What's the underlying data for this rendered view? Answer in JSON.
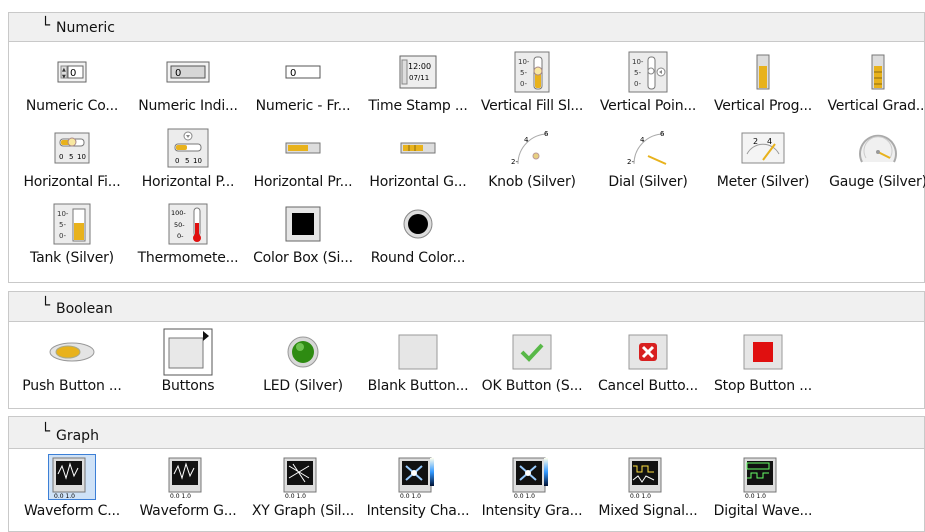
{
  "sections": [
    {
      "header": "Numeric",
      "header_mark": "└",
      "items": [
        {
          "label": "Numeric Co...",
          "icon": "numeric-control-icon"
        },
        {
          "label": "Numeric Indi...",
          "icon": "numeric-indicator-icon"
        },
        {
          "label": "Numeric - Fr...",
          "icon": "numeric-frameless-icon"
        },
        {
          "label": "Time Stamp ...",
          "icon": "timestamp-icon",
          "icon_text": [
            "12:00",
            "07/11"
          ]
        },
        {
          "label": "Vertical Fill Sl...",
          "icon": "vertical-fill-slide-icon",
          "icon_text": [
            "10-",
            "5-",
            "0-"
          ]
        },
        {
          "label": "Vertical Poin...",
          "icon": "vertical-pointer-slide-icon",
          "icon_text": [
            "10-",
            "5-",
            "0-"
          ]
        },
        {
          "label": "Vertical Prog...",
          "icon": "vertical-progress-bar-icon"
        },
        {
          "label": "Vertical Grad...",
          "icon": "vertical-graduated-bar-icon"
        },
        {
          "label": "Horizontal Fi...",
          "icon": "horizontal-fill-slide-icon",
          "icon_text": [
            "0",
            "5",
            "10"
          ]
        },
        {
          "label": "Horizontal P...",
          "icon": "horizontal-pointer-slide-icon",
          "icon_text": [
            "0",
            "5",
            "10"
          ]
        },
        {
          "label": "Horizontal Pr...",
          "icon": "horizontal-progress-bar-icon"
        },
        {
          "label": "Horizontal G...",
          "icon": "horizontal-graduated-bar-icon"
        },
        {
          "label": "Knob (Silver)",
          "icon": "knob-icon",
          "icon_text": [
            "2-",
            "4",
            "6"
          ]
        },
        {
          "label": "Dial (Silver)",
          "icon": "dial-icon",
          "icon_text": [
            "2-",
            "4",
            "6"
          ]
        },
        {
          "label": "Meter (Silver)",
          "icon": "meter-icon",
          "icon_text": [
            "2",
            "4"
          ]
        },
        {
          "label": "Gauge (Silver)",
          "icon": "gauge-icon"
        },
        {
          "label": "Tank (Silver)",
          "icon": "tank-icon",
          "icon_text": [
            "10-",
            "5-",
            "0-"
          ]
        },
        {
          "label": "Thermomete...",
          "icon": "thermometer-icon",
          "icon_text": [
            "100-",
            "50-",
            "0-"
          ]
        },
        {
          "label": "Color Box (Si...",
          "icon": "color-box-icon"
        },
        {
          "label": "Round Color...",
          "icon": "round-color-box-icon"
        }
      ]
    },
    {
      "header": "Boolean",
      "header_mark": "└",
      "items": [
        {
          "label": "Push Button ...",
          "icon": "push-button-icon"
        },
        {
          "label": "Buttons",
          "icon": "buttons-folder-icon"
        },
        {
          "label": "LED (Silver)",
          "icon": "led-icon"
        },
        {
          "label": "Blank Button...",
          "icon": "blank-button-icon"
        },
        {
          "label": "OK Button (S...",
          "icon": "ok-button-icon"
        },
        {
          "label": "Cancel Butto...",
          "icon": "cancel-button-icon"
        },
        {
          "label": "Stop Button ...",
          "icon": "stop-button-icon"
        }
      ]
    },
    {
      "header": "Graph",
      "header_mark": "└",
      "items": [
        {
          "label": "Waveform C...",
          "icon": "waveform-chart-icon"
        },
        {
          "label": "Waveform G...",
          "icon": "waveform-graph-icon"
        },
        {
          "label": "XY Graph (Sil...",
          "icon": "xy-graph-icon"
        },
        {
          "label": "Intensity Cha...",
          "icon": "intensity-chart-icon"
        },
        {
          "label": "Intensity Gra...",
          "icon": "intensity-graph-icon"
        },
        {
          "label": "Mixed Signal...",
          "icon": "mixed-signal-graph-icon"
        },
        {
          "label": "Digital Wave...",
          "icon": "digital-waveform-icon"
        }
      ]
    }
  ],
  "colors": {
    "fill": "#e8b21c",
    "panel": "#f0f0f0",
    "led": "#2e8b12",
    "stop": "#e01010",
    "cancel": "#d82020",
    "ok": "#58b848",
    "selected": "#3c7fd6"
  },
  "selected_item": "Waveform C..."
}
